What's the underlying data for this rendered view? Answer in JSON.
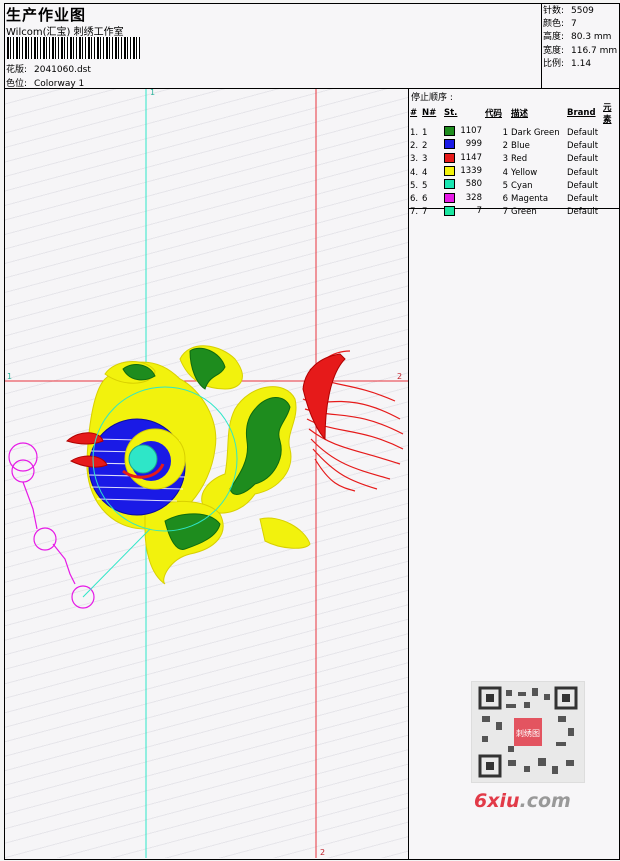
{
  "header": {
    "title": "生产作业图",
    "company": "Wilcom(汇宝) 刺绣工作室",
    "design_label": "花版:",
    "design_file": "2041060.dst",
    "colorway_label": "色位:",
    "colorway": "Colorway 1"
  },
  "stats": {
    "stitches_label": "针数:",
    "stitches": "5509",
    "colors_label": "颜色:",
    "colors": "7",
    "height_label": "高度:",
    "height": "80.3 mm",
    "width_label": "宽度:",
    "width": "116.7 mm",
    "scale_label": "比例:",
    "scale": "1.14"
  },
  "stop_sequence_label": "停止顺序 :",
  "table": {
    "headers": [
      "#",
      "N#",
      "St.",
      "代码",
      "描述",
      "Brand",
      "元素"
    ],
    "rows": [
      {
        "idx": "1.",
        "n": "1",
        "color": "#1e8c1e",
        "st": "1107",
        "code": "1",
        "desc": "Dark Green",
        "brand": "Default"
      },
      {
        "idx": "2.",
        "n": "2",
        "color": "#1a1ae6",
        "st": "999",
        "code": "2",
        "desc": "Blue",
        "brand": "Default"
      },
      {
        "idx": "3.",
        "n": "3",
        "color": "#e61a1a",
        "st": "1147",
        "code": "3",
        "desc": "Red",
        "brand": "Default"
      },
      {
        "idx": "4.",
        "n": "4",
        "color": "#f2f20d",
        "st": "1339",
        "code": "4",
        "desc": "Yellow",
        "brand": "Default"
      },
      {
        "idx": "5.",
        "n": "5",
        "color": "#1ae6b3",
        "st": "580",
        "code": "5",
        "desc": "Cyan",
        "brand": "Default"
      },
      {
        "idx": "6.",
        "n": "6",
        "color": "#e61ae6",
        "st": "328",
        "code": "6",
        "desc": "Magenta",
        "brand": "Default"
      },
      {
        "idx": "7.",
        "n": "7",
        "color": "#1ae6a0",
        "st": "7",
        "code": "7",
        "desc": "Green",
        "brand": "Default"
      }
    ]
  },
  "guides": {
    "v1": "1",
    "h1_left": "1",
    "h1_right": "2",
    "v2": "2"
  },
  "watermark": {
    "text": "6xiu",
    "suffix": ".com",
    "qr_text": "刺绣图"
  }
}
